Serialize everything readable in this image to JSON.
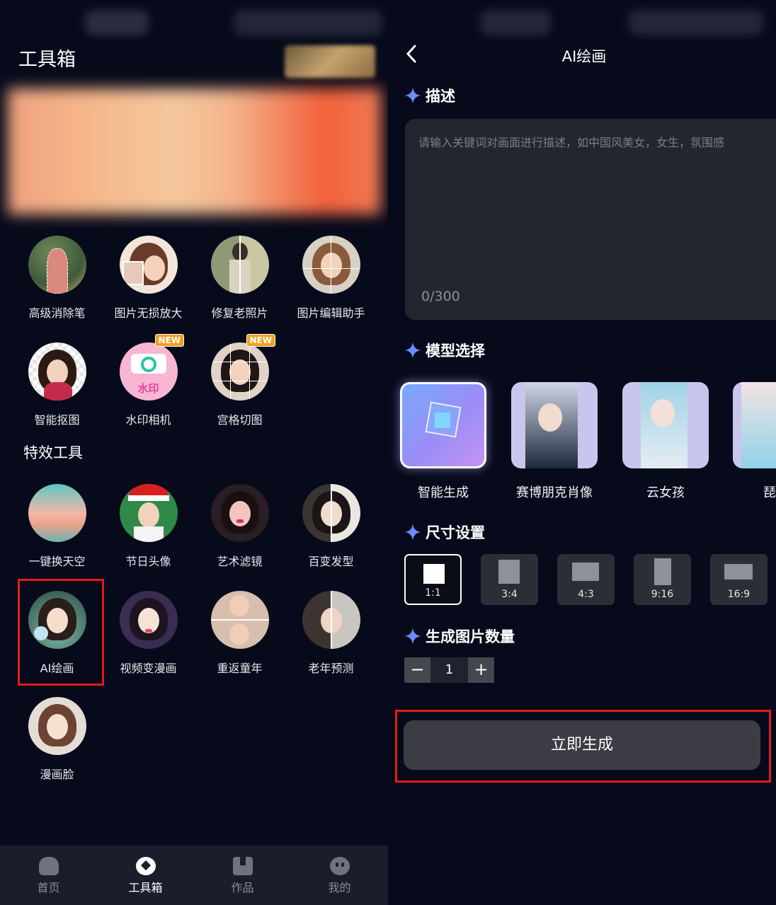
{
  "left": {
    "title": "工具箱",
    "tools_row1": [
      {
        "label": "高级消除笔"
      },
      {
        "label": "图片无损放大"
      },
      {
        "label": "修复老照片"
      },
      {
        "label": "图片编辑助手"
      }
    ],
    "tools_row2": [
      {
        "label": "智能抠图"
      },
      {
        "label": "水印相机",
        "badge": "NEW",
        "icon_text": "水印"
      },
      {
        "label": "宫格切图",
        "badge": "NEW"
      }
    ],
    "effects_title": "特效工具",
    "effects_row1": [
      {
        "label": "一键换天空"
      },
      {
        "label": "节日头像"
      },
      {
        "label": "艺术滤镜"
      },
      {
        "label": "百变发型"
      }
    ],
    "effects_row2": [
      {
        "label": "AI绘画"
      },
      {
        "label": "视频变漫画"
      },
      {
        "label": "重返童年"
      },
      {
        "label": "老年预测"
      }
    ],
    "effects_row3": [
      {
        "label": "漫画脸"
      }
    ],
    "tabs": [
      {
        "label": "首页",
        "icon": "home-icon"
      },
      {
        "label": "工具箱",
        "icon": "toolbox-icon",
        "active": true
      },
      {
        "label": "作品",
        "icon": "bookmark-icon"
      },
      {
        "label": "我的",
        "icon": "smiley-icon"
      }
    ]
  },
  "right": {
    "title": "AI绘画",
    "sections": {
      "description": "描述",
      "model": "模型选择",
      "size": "尺寸设置",
      "count": "生成图片数量"
    },
    "description_placeholder": "请输入关键词对画面进行描述，如中国风美女，女生，氛围感",
    "description_counter": "0/300",
    "models": [
      {
        "label": "智能生成",
        "selected": true
      },
      {
        "label": "赛博朋克肖像"
      },
      {
        "label": "云女孩"
      },
      {
        "label": "琵琶"
      }
    ],
    "sizes": [
      {
        "label": "1:1",
        "selected": true
      },
      {
        "label": "3:4"
      },
      {
        "label": "4:3"
      },
      {
        "label": "9:16"
      },
      {
        "label": "16:9"
      }
    ],
    "count_minus": "−",
    "count_value": "1",
    "count_plus": "+",
    "generate_button": "立即生成"
  },
  "colors": {
    "background": "#070a1a",
    "accent_sparkle": "#6b8cff",
    "highlight_box": "#e21b1b",
    "new_badge": "#f0a021"
  }
}
